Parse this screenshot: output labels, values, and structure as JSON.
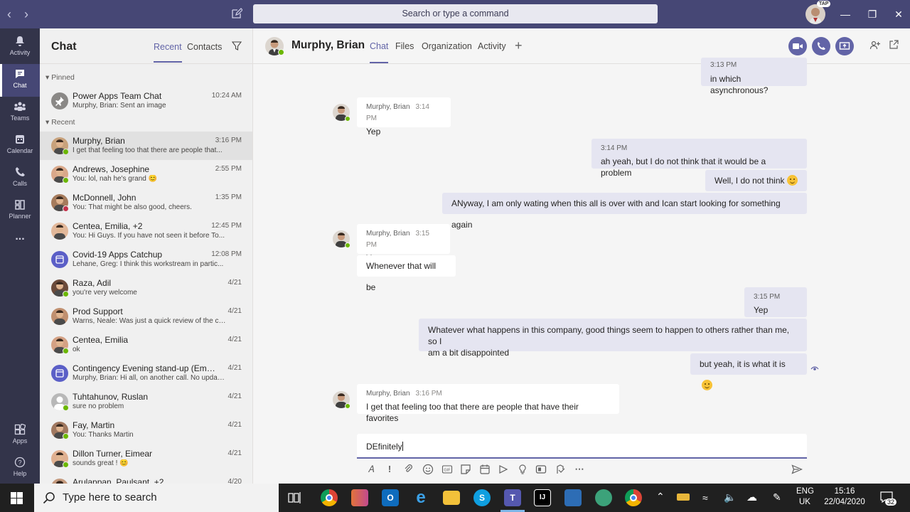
{
  "titlebar": {
    "search_placeholder": "Search or type a command",
    "badge": "TAP"
  },
  "rail": [
    {
      "label": "Activity",
      "icon": "bell-icon"
    },
    {
      "label": "Chat",
      "icon": "chat-icon",
      "active": true
    },
    {
      "label": "Teams",
      "icon": "teams-icon"
    },
    {
      "label": "Calendar",
      "icon": "calendar-icon"
    },
    {
      "label": "Calls",
      "icon": "phone-icon"
    },
    {
      "label": "Planner",
      "icon": "planner-icon"
    },
    {
      "label": "...",
      "icon": "more-icon"
    },
    {
      "label": "Apps",
      "icon": "apps-icon"
    },
    {
      "label": "Help",
      "icon": "help-icon"
    }
  ],
  "sidebar": {
    "title": "Chat",
    "tabs": [
      "Recent",
      "Contacts"
    ],
    "pinned_label": "Pinned",
    "recent_label": "Recent",
    "pinned": [
      {
        "name": "Power Apps Team Chat",
        "preview": "Murphy, Brian: Sent an image",
        "time": "10:24 AM"
      }
    ],
    "recent": [
      {
        "name": "Murphy, Brian",
        "preview": "I get that feeling too that there are people that...",
        "time": "3:16 PM",
        "status": "available"
      },
      {
        "name": "Andrews, Josephine",
        "preview": "You: lol, nah he's grand 😊",
        "time": "2:55 PM",
        "status": "available"
      },
      {
        "name": "McDonnell, John",
        "preview": "You: That might be also good, cheers.",
        "time": "1:35 PM",
        "status": "busy"
      },
      {
        "name": "Centea, Emilia, +2",
        "preview": "You: Hi Guys. If you have not seen it before To...",
        "time": "12:45 PM",
        "status": ""
      },
      {
        "name": "Covid-19 Apps Catchup",
        "preview": "Lehane, Greg: I think this workstream in partic...",
        "time": "12:08 PM",
        "status": ""
      },
      {
        "name": "Raza, Adil",
        "preview": "you're very welcome",
        "time": "4/21",
        "status": "available"
      },
      {
        "name": "Prod Support",
        "preview": "Warns, Neale: Was just a quick review of the cont...",
        "time": "4/21",
        "status": ""
      },
      {
        "name": "Centea, Emilia",
        "preview": "ok",
        "time": "4/21",
        "status": "available"
      },
      {
        "name": "Contingency Evening stand-up (Emerg...",
        "preview": "Murphy, Brian: Hi all, on another call. No updates...",
        "time": "4/21",
        "status": ""
      },
      {
        "name": "Tuhtahunov, Ruslan",
        "preview": "sure no problem",
        "time": "4/21",
        "status": "available"
      },
      {
        "name": "Fay, Martin",
        "preview": "You: Thanks Martin",
        "time": "4/21",
        "status": "available"
      },
      {
        "name": "Dillon Turner, Eimear",
        "preview": "sounds great ! 😊",
        "time": "4/21",
        "status": "available"
      },
      {
        "name": "Arulappan, Paulsant, +2",
        "preview": "",
        "time": "4/20",
        "status": ""
      }
    ]
  },
  "header": {
    "name": "Murphy, Brian",
    "tabs": [
      "Chat",
      "Files",
      "Organization",
      "Activity"
    ],
    "plus": "+"
  },
  "messages": {
    "partial_time": "3:13 PM",
    "partial_text": "in which asynchronous?",
    "m1_sender": "Murphy, Brian",
    "m1_time": "3:14 PM",
    "m1_text": "Yep",
    "o1_time": "3:14 PM",
    "o1_text": "ah yeah, but I do not think that it would be a problem",
    "o2_text": "Well, I do not think",
    "o3_text": "ANyway, I am only wating when this all is over with and  Ican start looking for something again",
    "m2_sender": "Murphy, Brian",
    "m2_time": "3:15 PM",
    "m2_text": "Yep same",
    "m3_text": "Whenever that will be",
    "o4_time": "3:15 PM",
    "o4_text": "Yep",
    "o5_line1": "Whatever what happens in this company, good things seem to happen to others rather than me, so I",
    "o5_line2": "am a bit disappointed",
    "o6_text": "but yeah, it is what it is",
    "m4_sender": "Murphy, Brian",
    "m4_time": "3:16 PM",
    "m4_text": "I get that feeling too that there are people that have their favorites"
  },
  "compose": {
    "value": "DEfinitely"
  },
  "taskbar": {
    "search_placeholder": "Type here to search",
    "lang_top": "ENG",
    "lang_bottom": "UK",
    "time": "15:16",
    "date": "22/04/2020",
    "notif_count": "32"
  }
}
